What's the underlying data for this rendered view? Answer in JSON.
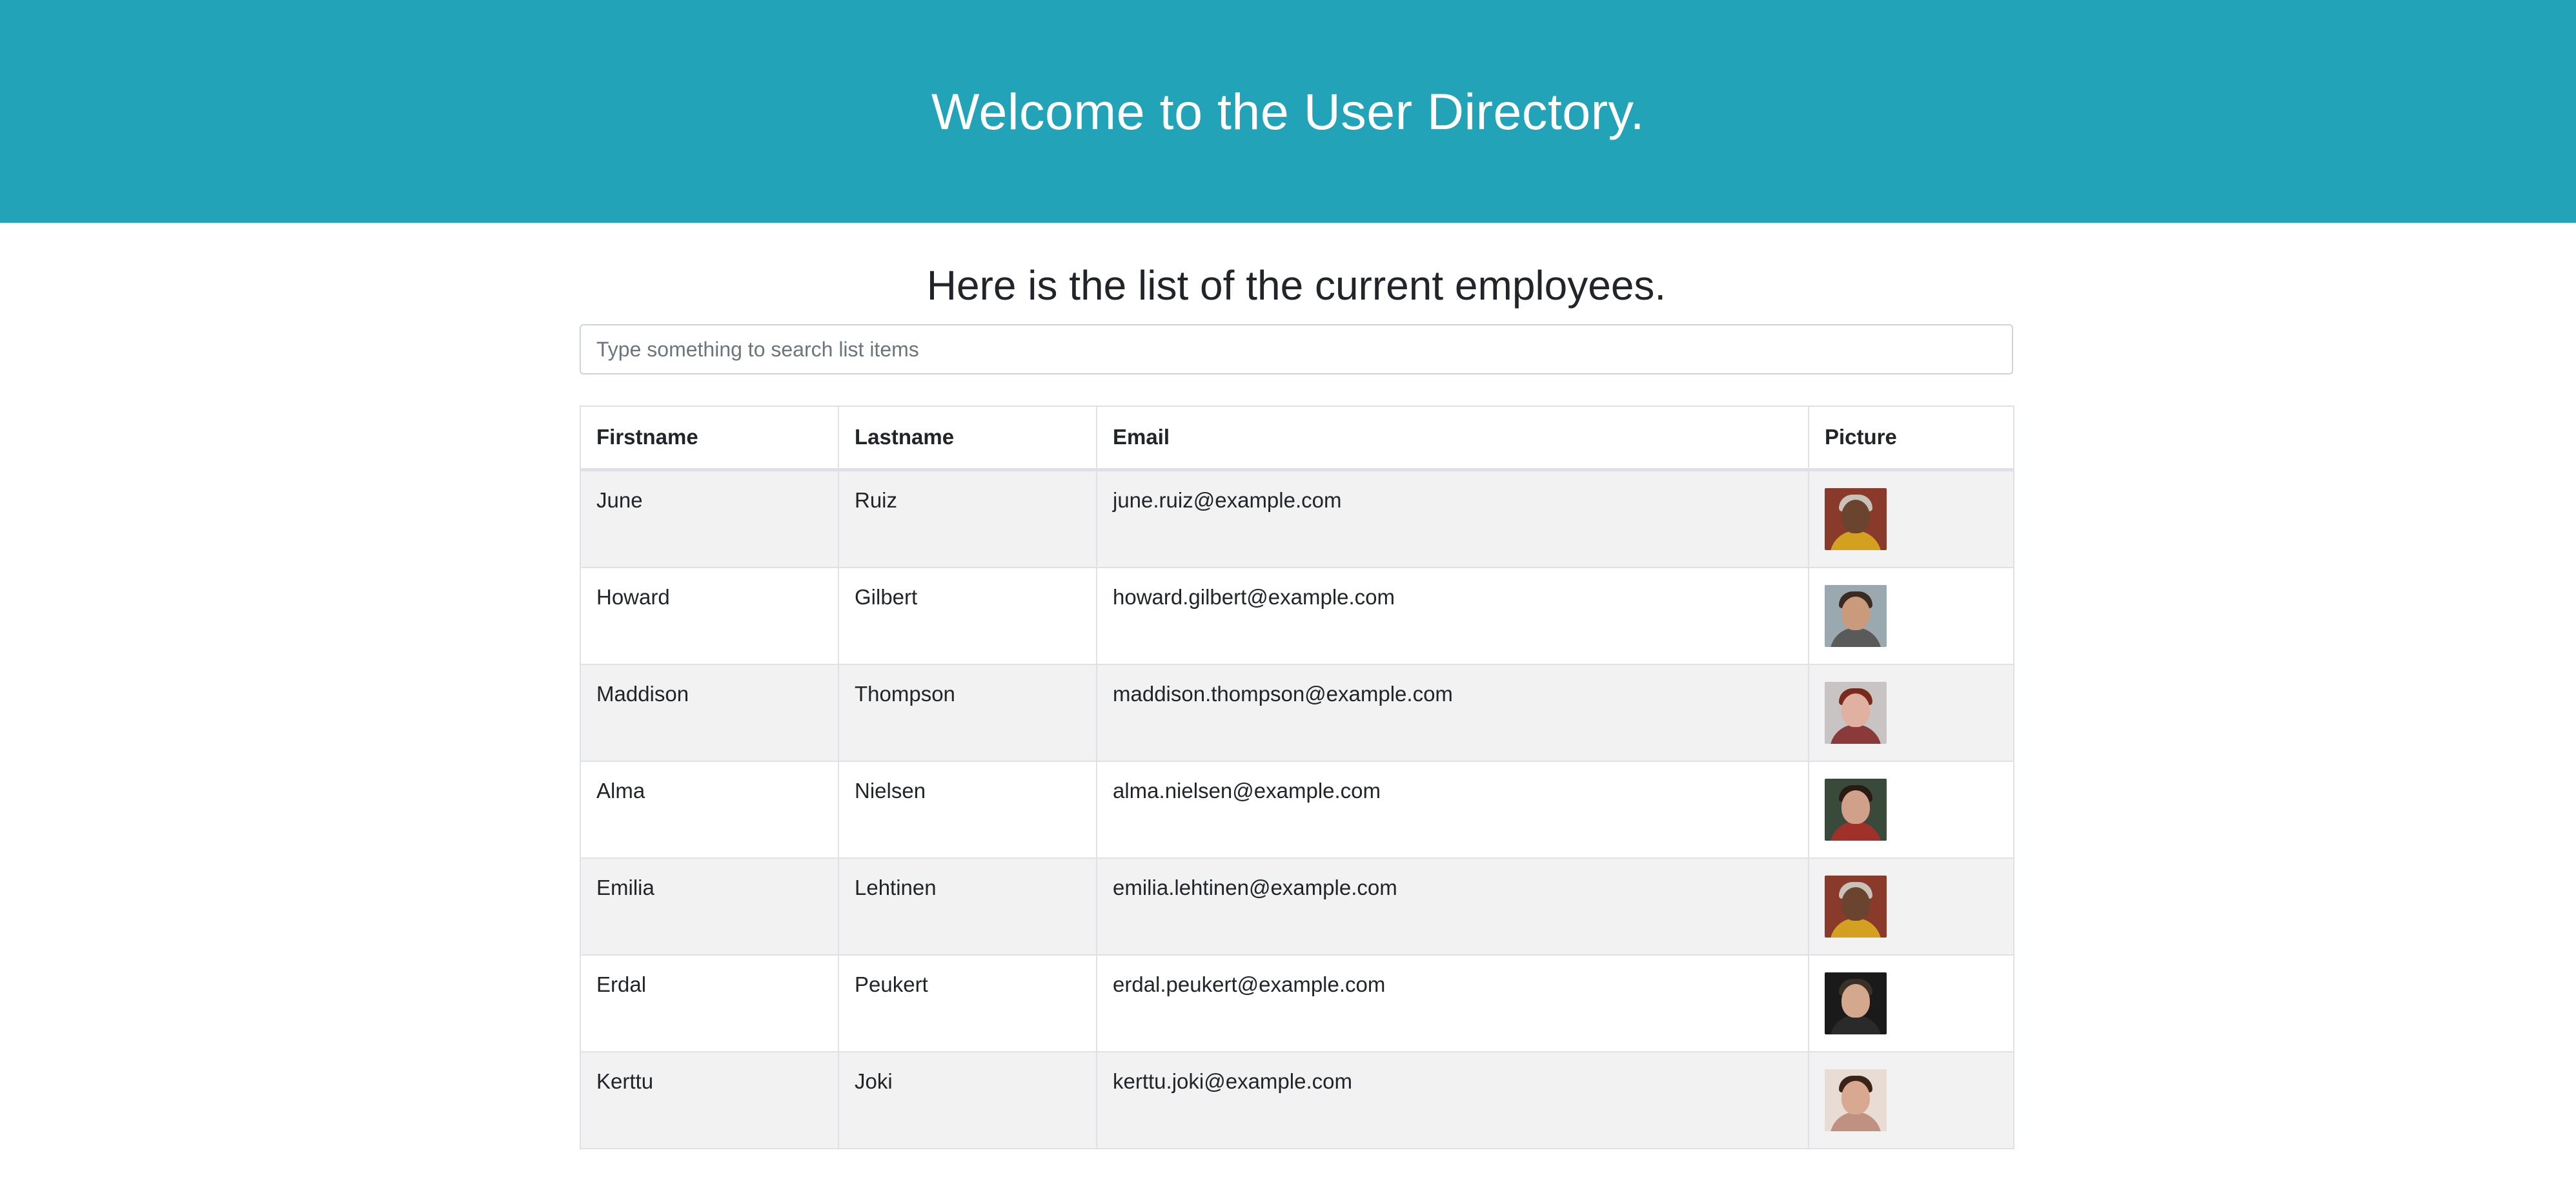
{
  "header": {
    "title": "Welcome to the User Directory."
  },
  "main": {
    "subtitle": "Here is the list of the current employees.",
    "search": {
      "placeholder": "Type something to search list items",
      "value": ""
    }
  },
  "table": {
    "columns": [
      "Firstname",
      "Lastname",
      "Email",
      "Picture"
    ],
    "rows": [
      {
        "firstname": "June",
        "lastname": "Ruiz",
        "email": "june.ruiz@example.com",
        "picture": {
          "bg": "#8a3a2a",
          "face": "#6b4430",
          "shirt": "#d4a020",
          "hair": "#c9c2b8"
        }
      },
      {
        "firstname": "Howard",
        "lastname": "Gilbert",
        "email": "howard.gilbert@example.com",
        "picture": {
          "bg": "#9aa8b0",
          "face": "#c99a7c",
          "shirt": "#5a5a5a",
          "hair": "#3a2a20"
        }
      },
      {
        "firstname": "Maddison",
        "lastname": "Thompson",
        "email": "maddison.thompson@example.com",
        "picture": {
          "bg": "#c8c4c4",
          "face": "#e0b0a0",
          "shirt": "#8a3a3a",
          "hair": "#7a2a1a"
        }
      },
      {
        "firstname": "Alma",
        "lastname": "Nielsen",
        "email": "alma.nielsen@example.com",
        "picture": {
          "bg": "#3a4a3a",
          "face": "#d0a08a",
          "shirt": "#a0302a",
          "hair": "#2a1a14"
        }
      },
      {
        "firstname": "Emilia",
        "lastname": "Lehtinen",
        "email": "emilia.lehtinen@example.com",
        "picture": {
          "bg": "#8a3a2a",
          "face": "#6b4430",
          "shirt": "#d4a020",
          "hair": "#c9c2b8"
        }
      },
      {
        "firstname": "Erdal",
        "lastname": "Peukert",
        "email": "erdal.peukert@example.com",
        "picture": {
          "bg": "#1a1a1a",
          "face": "#d4a88c",
          "shirt": "#2a2a2a",
          "hair": "#3a3028"
        }
      },
      {
        "firstname": "Kerttu",
        "lastname": "Joki",
        "email": "kerttu.joki@example.com",
        "picture": {
          "bg": "#e8dcd4",
          "face": "#d8a890",
          "shirt": "#c09080",
          "hair": "#3a2418"
        }
      }
    ]
  },
  "colors": {
    "hero_bg": "#23a3b8",
    "stripe": "#f2f2f2",
    "border": "#dee2e6"
  }
}
